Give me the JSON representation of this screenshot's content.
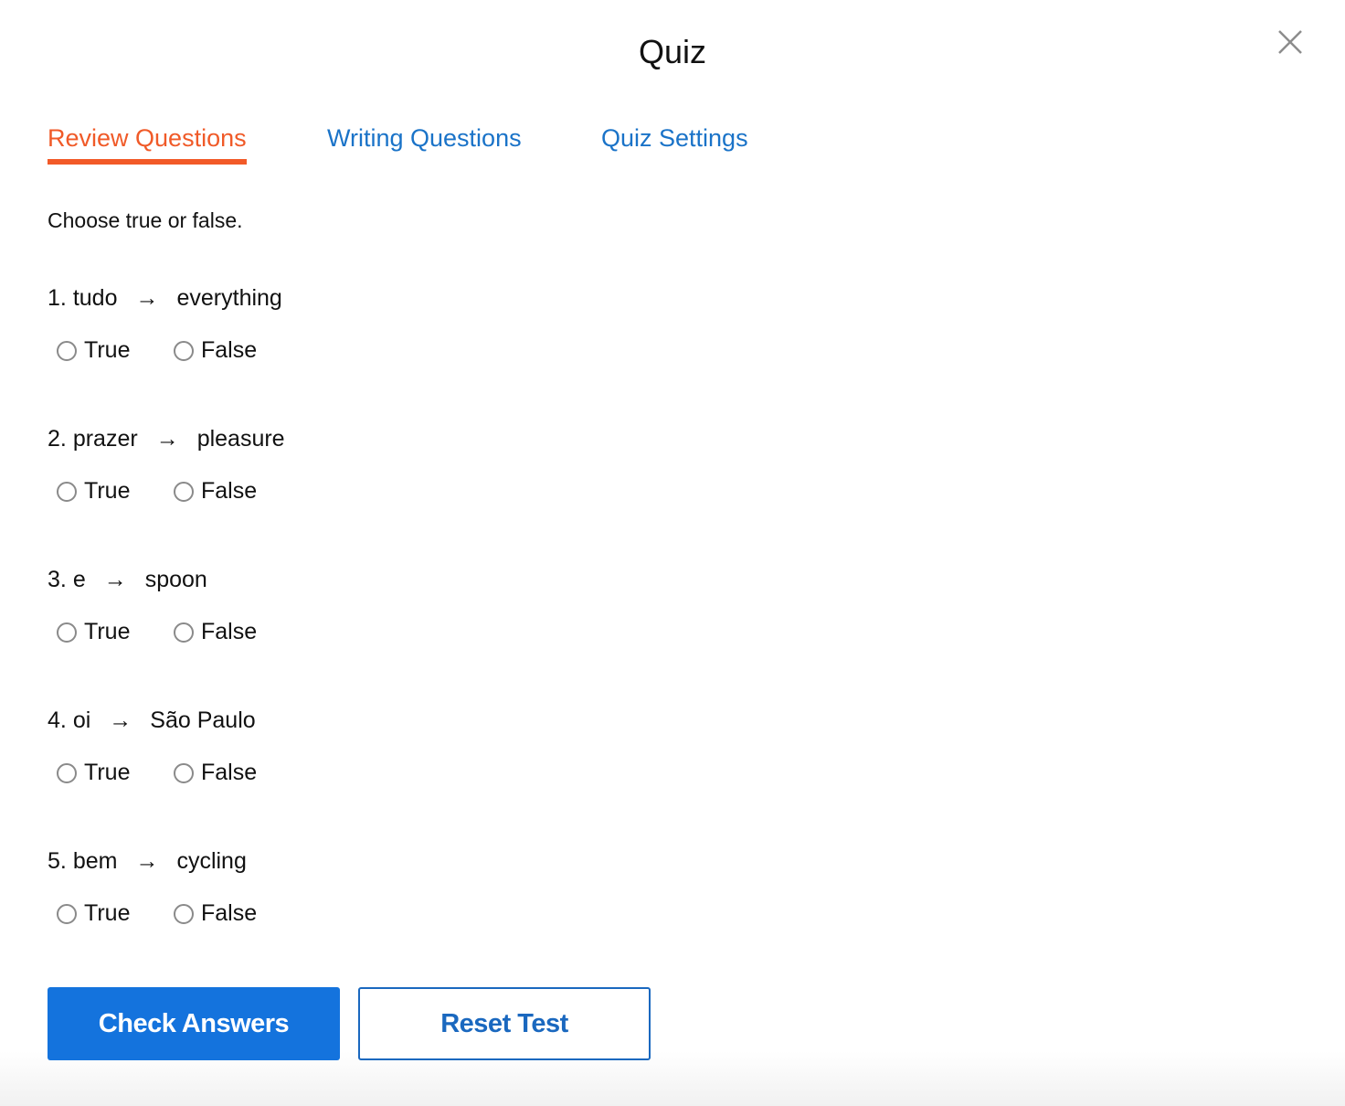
{
  "dialog": {
    "title": "Quiz",
    "close_icon": "close-icon"
  },
  "tabs": [
    {
      "label": "Review Questions",
      "active": true
    },
    {
      "label": "Writing Questions",
      "active": false
    },
    {
      "label": "Quiz Settings",
      "active": false
    }
  ],
  "colors": {
    "active_tab": "#f05a28",
    "tab_link": "#1a73c8",
    "primary_button": "#1473dd",
    "secondary_border": "#1a68bf"
  },
  "instruction": "Choose true or false.",
  "arrow": "→",
  "questions": [
    {
      "number": "1.",
      "term": "tudo",
      "definition": "everything",
      "true_label": "True",
      "false_label": "False",
      "selected": null
    },
    {
      "number": "2.",
      "term": "prazer",
      "definition": "pleasure",
      "true_label": "True",
      "false_label": "False",
      "selected": null
    },
    {
      "number": "3.",
      "term": "e",
      "definition": "spoon",
      "true_label": "True",
      "false_label": "False",
      "selected": null
    },
    {
      "number": "4.",
      "term": "oi",
      "definition": "São Paulo",
      "true_label": "True",
      "false_label": "False",
      "selected": null
    },
    {
      "number": "5.",
      "term": "bem",
      "definition": "cycling",
      "true_label": "True",
      "false_label": "False",
      "selected": null
    }
  ],
  "buttons": {
    "check": "Check Answers",
    "reset": "Reset Test"
  }
}
